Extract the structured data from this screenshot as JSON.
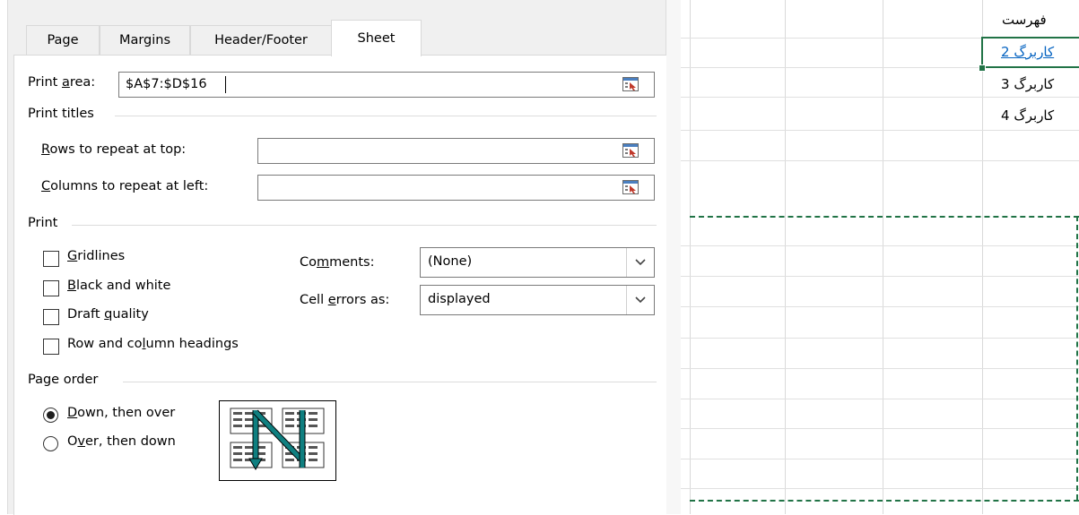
{
  "dialog": {
    "tabs": [
      {
        "label": "Page",
        "active": false
      },
      {
        "label": "Margins",
        "active": false
      },
      {
        "label": "Header/Footer",
        "active": false
      },
      {
        "label": "Sheet",
        "active": true
      }
    ],
    "print_area": {
      "label_pre": "Print ",
      "label_key": "a",
      "label_post": "rea:",
      "value": "$A$7:$D$16"
    },
    "print_titles": {
      "heading": "Print titles",
      "rows_label_key": "R",
      "rows_label_rest": "ows to repeat at top:",
      "rows_value": "",
      "cols_label_key": "C",
      "cols_label_rest": "olumns to repeat at left:",
      "cols_value": ""
    },
    "print": {
      "heading": "Print",
      "checkboxes": [
        {
          "key": "G",
          "rest": "ridlines",
          "checked": false
        },
        {
          "key": "B",
          "rest": "lack and white",
          "checked": false
        },
        {
          "pre": "Draft ",
          "key": "q",
          "rest": "uality",
          "checked": false
        },
        {
          "pre": "Row and co",
          "key": "l",
          "rest": "umn headings",
          "checked": false
        }
      ],
      "comments": {
        "pre": "Co",
        "key": "m",
        "rest": "ments:",
        "value": "(None)"
      },
      "cell_errors": {
        "pre": "Cell ",
        "key": "e",
        "rest": "rrors as:",
        "value": "displayed"
      }
    },
    "page_order": {
      "heading": "Page order",
      "options": [
        {
          "key": "D",
          "rest": "own, then over",
          "selected": true
        },
        {
          "pre": "O",
          "key": "v",
          "rest": "er, then down",
          "selected": false
        }
      ],
      "preview_icon": "page-order-down-then-over-icon"
    }
  },
  "sheet": {
    "cells": [
      {
        "text": "فهرست",
        "link": false
      },
      {
        "text": "کاربرگ 2",
        "link": true
      },
      {
        "text": "کاربرگ 3",
        "link": false
      },
      {
        "text": "کاربرگ 4",
        "link": false
      }
    ],
    "colors": {
      "grid": "#d9d9d9",
      "page_break": "#217346",
      "selection": "#217346",
      "link": "#0563c1"
    }
  }
}
